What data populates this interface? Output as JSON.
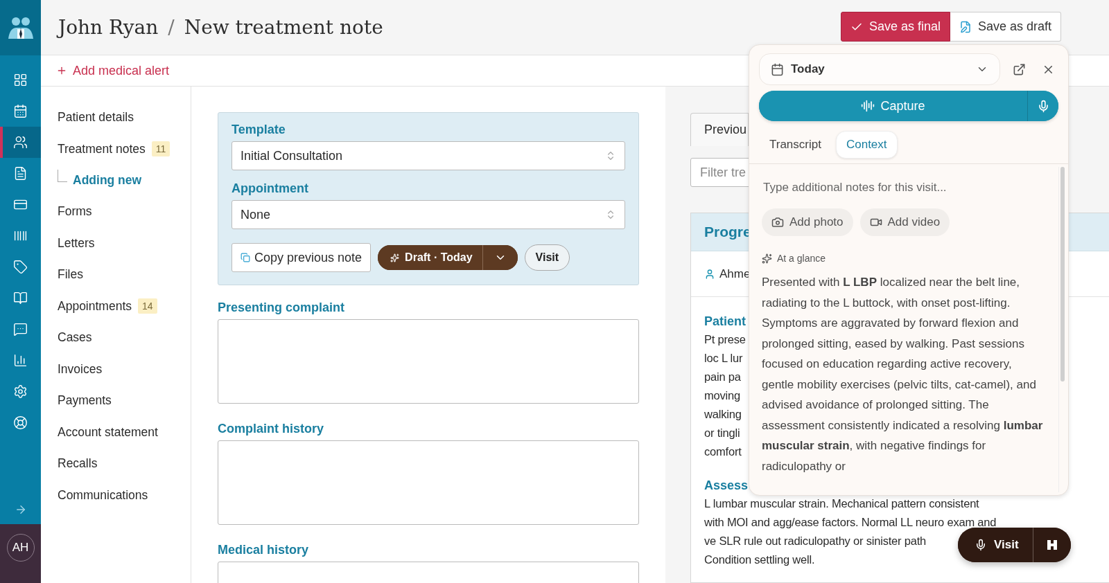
{
  "header": {
    "patient": "John Ryan",
    "separator": "/",
    "page": "New treatment note",
    "actions": [
      {
        "label": "Save as final",
        "kind": "primary"
      },
      {
        "label": "Save as draft",
        "kind": "secondary"
      }
    ]
  },
  "rail": {
    "items": [
      {
        "selected": false
      },
      {
        "selected": false
      },
      {
        "selected": true
      },
      {
        "selected": false
      },
      {
        "selected": false
      },
      {
        "selected": false
      },
      {
        "selected": false
      },
      {
        "selected": false
      },
      {
        "selected": false
      },
      {
        "selected": false
      },
      {
        "selected": false
      },
      {
        "selected": false
      }
    ],
    "avatar": "AH"
  },
  "alert": {
    "label": "Add medical alert"
  },
  "nav": {
    "items": [
      {
        "label": "Patient details",
        "selected": false
      },
      {
        "label": "Treatment notes",
        "badge": "11",
        "selected": false,
        "children": [
          {
            "label": "Adding new",
            "selected": true
          }
        ]
      },
      {
        "label": "Forms",
        "selected": false
      },
      {
        "label": "Letters",
        "selected": false
      },
      {
        "label": "Files",
        "selected": false
      },
      {
        "label": "Appointments",
        "badge": "14",
        "selected": false
      },
      {
        "label": "Cases",
        "selected": false
      },
      {
        "label": "Invoices",
        "selected": false
      },
      {
        "label": "Payments",
        "selected": false
      },
      {
        "label": "Account statement",
        "selected": false
      },
      {
        "label": "Recalls",
        "selected": false
      },
      {
        "label": "Communications",
        "selected": false
      }
    ]
  },
  "form": {
    "template": {
      "label": "Template",
      "value": "Initial Consultation"
    },
    "appointment": {
      "label": "Appointment",
      "value": "None"
    },
    "copy_button": "Copy previous note",
    "draft_button": "Draft · Today",
    "visit_button": "Visit",
    "sections": [
      {
        "label": "Presenting complaint"
      },
      {
        "label": "Complaint history"
      },
      {
        "label": "Medical history"
      }
    ]
  },
  "previous": {
    "tab": "Previou",
    "filter_placeholder": "Filter tre",
    "card": {
      "title": "Progre",
      "author": "Ahme",
      "sections": [
        {
          "heading": "Patient",
          "lines": [
            "Pt prese",
            "loc L lur",
            "pain pa",
            "moving",
            "walking",
            "or tingli",
            "comfort"
          ]
        },
        {
          "heading": "Assess",
          "lines": [
            "L lumbar muscular strain. Mechanical pattern consistent",
            "with MOI and agg/ease factors. Normal LL neuro exam and",
            "ve SLR rule out radiculopathy or sinister path",
            "Condition settling well."
          ]
        }
      ]
    }
  },
  "assistant": {
    "date": "Today",
    "capture": "Capture",
    "tabs": [
      {
        "label": "Transcript",
        "selected": false
      },
      {
        "label": "Context",
        "selected": true
      }
    ],
    "notes_placeholder": "Type additional notes for this visit...",
    "media_buttons": [
      "Add photo",
      "Add video"
    ],
    "glance_title": "At a glance",
    "summary": "Presented with **L LBP** localized near the belt line, radiating to the L buttock, with onset post-lifting. Symptoms are aggravated by forward flexion and prolonged sitting, eased by walking. Past sessions focused on education regarding active recovery, gentle mobility exercises (pelvic tilts, cat-camel), and advised avoidance of prolonged sitting. The assessment consistently indicated a resolving **lumbar muscular strain**, with negative findings for radiculopathy or"
  },
  "floating": {
    "label": "Visit"
  }
}
